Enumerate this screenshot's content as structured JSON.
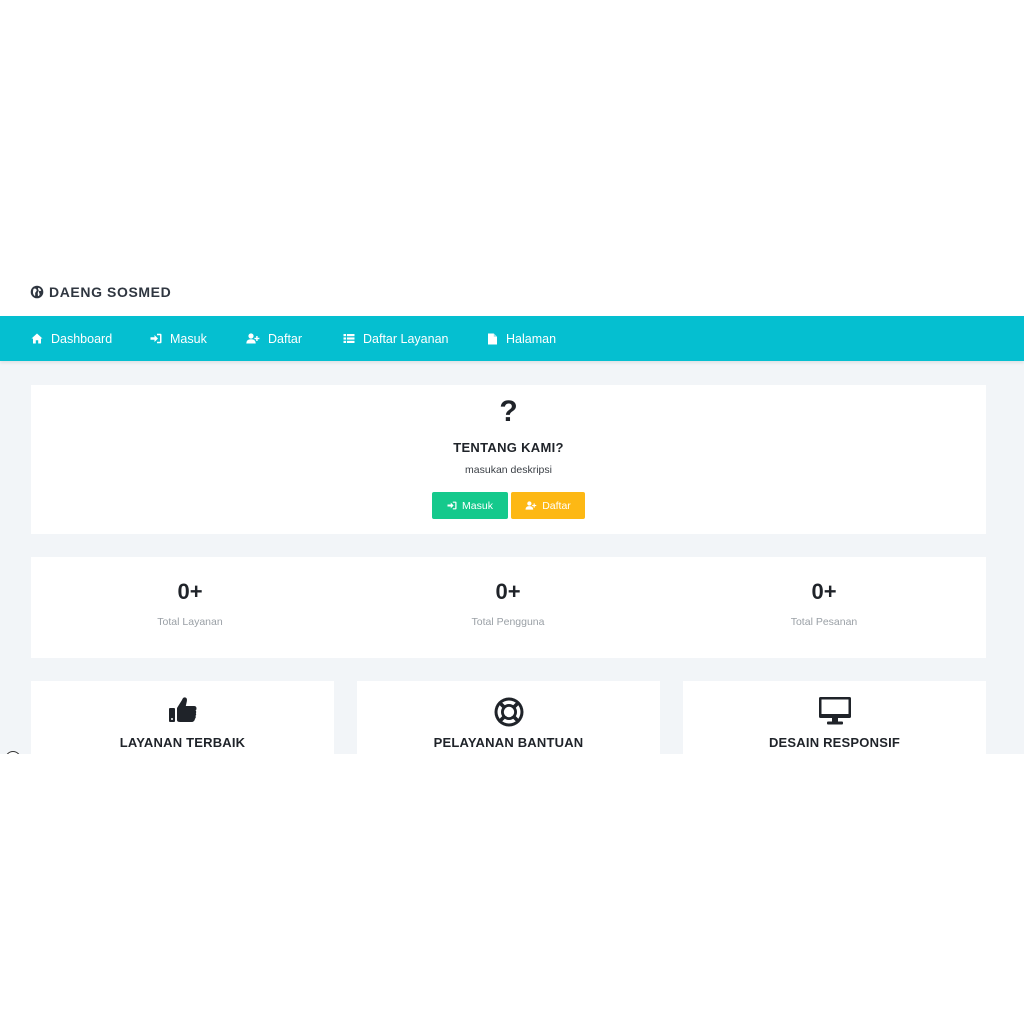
{
  "brand": {
    "title": "DAENG SOSMED",
    "icon": "globe-icon"
  },
  "nav": {
    "items": [
      {
        "label": "Dashboard",
        "icon": "home-icon"
      },
      {
        "label": "Masuk",
        "icon": "sign-in-icon"
      },
      {
        "label": "Daftar",
        "icon": "user-plus-icon"
      },
      {
        "label": "Daftar Layanan",
        "icon": "list-icon"
      },
      {
        "label": "Halaman",
        "icon": "file-icon"
      }
    ]
  },
  "about": {
    "icon_glyph": "?",
    "title": "TENTANG KAMI?",
    "description": "masukan deskripsi",
    "buttons": [
      {
        "label": "Masuk",
        "icon": "sign-in-icon",
        "color": "#15c98c"
      },
      {
        "label": "Daftar",
        "icon": "user-plus-icon",
        "color": "#fdb814"
      }
    ]
  },
  "stats": [
    {
      "value": "0+",
      "label": "Total Layanan"
    },
    {
      "value": "0+",
      "label": "Total Pengguna"
    },
    {
      "value": "0+",
      "label": "Total Pesanan"
    }
  ],
  "features": [
    {
      "title": "LAYANAN TERBAIK",
      "icon": "thumbs-up-icon"
    },
    {
      "title": "PELAYANAN BANTUAN",
      "icon": "life-ring-icon"
    },
    {
      "title": "DESAIN RESPONSIF",
      "icon": "desktop-icon"
    }
  ],
  "colors": {
    "navbar": "#05bfd0",
    "success": "#15c98c",
    "warning": "#fdb814",
    "background": "#f2f5f8"
  }
}
